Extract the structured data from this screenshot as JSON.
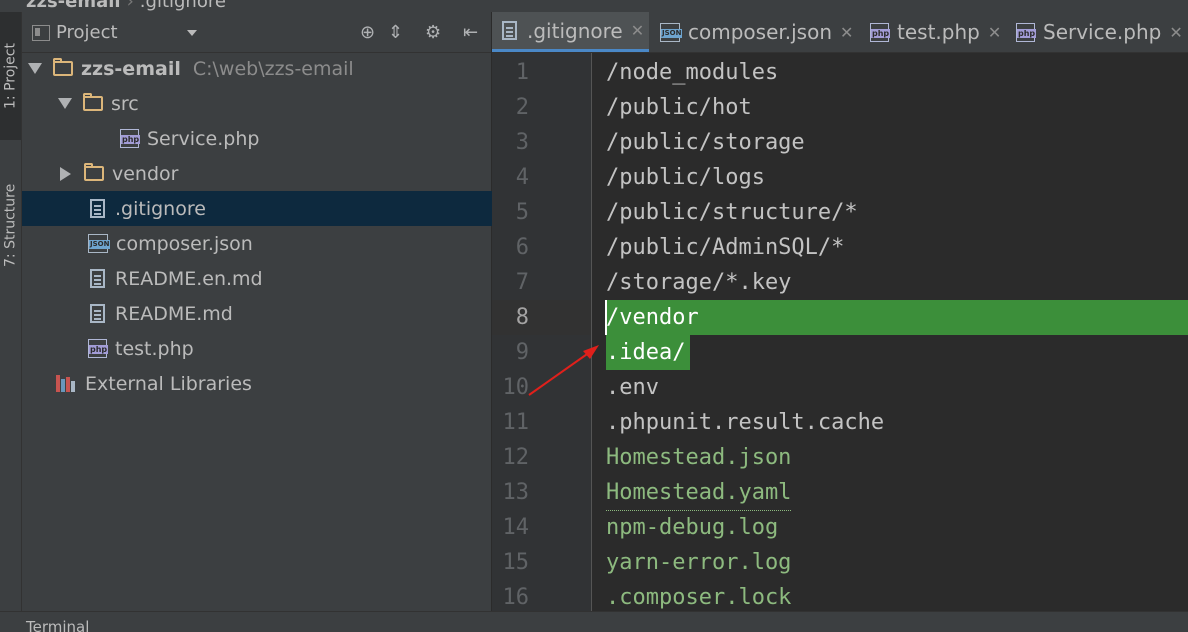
{
  "breadcrumb": {
    "project": "zzs-email",
    "file": ".gitignore"
  },
  "left_strip": {
    "project_tab": "1: Project",
    "structure_tab": "7: Structure"
  },
  "project_panel": {
    "title": "Project",
    "tree": {
      "root_name": "zzs-email",
      "root_path": "C:\\web\\zzs-email",
      "src_folder": "src",
      "src_file": "Service.php",
      "vendor_folder": "vendor",
      "gitignore": ".gitignore",
      "composer": "composer.json",
      "readme_en": "README.en.md",
      "readme": "README.md",
      "test": "test.php",
      "external": "External Libraries"
    }
  },
  "tabs": [
    {
      "label": ".gitignore",
      "icon": "file-icon",
      "active": true
    },
    {
      "label": "composer.json",
      "icon": "json-file-icon",
      "active": false
    },
    {
      "label": "test.php",
      "icon": "php-file-icon",
      "active": false
    },
    {
      "label": "Service.php",
      "icon": "php-file-icon",
      "active": false
    }
  ],
  "editor": {
    "lines": [
      {
        "n": "1",
        "text": "/node_modules"
      },
      {
        "n": "2",
        "text": "/public/hot"
      },
      {
        "n": "3",
        "text": "/public/storage"
      },
      {
        "n": "4",
        "text": "/public/logs"
      },
      {
        "n": "5",
        "text": "/public/structure/*"
      },
      {
        "n": "6",
        "text": "/public/AdminSQL/*"
      },
      {
        "n": "7",
        "text": "/storage/*.key"
      },
      {
        "n": "8",
        "text": "/vendor"
      },
      {
        "n": "9",
        "text": ".idea/"
      },
      {
        "n": "10",
        "text": ".env"
      },
      {
        "n": "11",
        "text": ".phpunit.result.cache"
      },
      {
        "n": "12",
        "text": "Homestead.json"
      },
      {
        "n": "13",
        "text": "Homestead.yaml"
      },
      {
        "n": "14",
        "text": "npm-debug.log"
      },
      {
        "n": "15",
        "text": "yarn-error.log"
      },
      {
        "n": "16",
        "text": ".composer.lock"
      }
    ]
  },
  "bottom": {
    "terminal": "Terminal"
  },
  "colors": {
    "selection": "#0d293e",
    "highlight": "#3c8f3a",
    "accent": "#4a88c7",
    "arrow": "#e0201b"
  }
}
